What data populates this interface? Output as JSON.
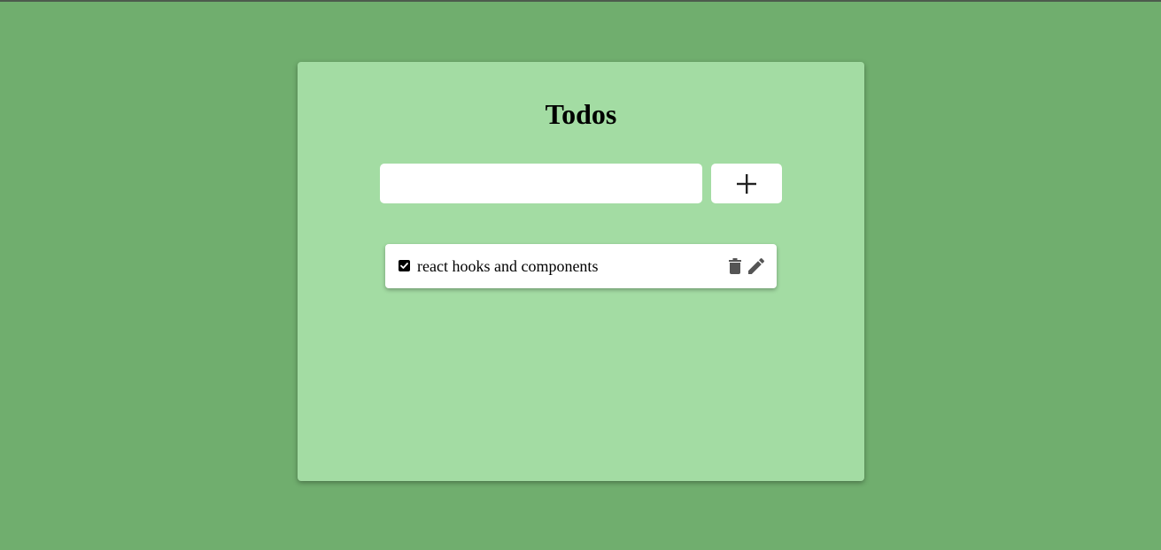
{
  "app": {
    "title": "Todos"
  },
  "add_form": {
    "input_value": "",
    "input_placeholder": "",
    "add_button_icon": "plus-icon"
  },
  "todos": [
    {
      "text": "react hooks and components",
      "completed": true,
      "delete_icon": "trash-icon",
      "edit_icon": "pencil-icon"
    }
  ],
  "colors": {
    "page_background": "#70ae6e",
    "card_background": "#a3dca3",
    "item_background": "#ffffff",
    "icon_color": "#555555"
  }
}
